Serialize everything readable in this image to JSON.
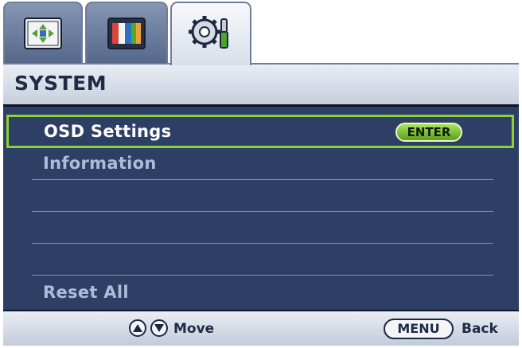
{
  "tabs": [
    {
      "icon": "display-adjust-icon",
      "active": false
    },
    {
      "icon": "picture-icon",
      "active": false
    },
    {
      "icon": "system-gear-icon",
      "active": true
    }
  ],
  "header": {
    "title": "SYSTEM"
  },
  "menu": {
    "items": [
      {
        "label": "OSD Settings",
        "selected": true,
        "badge": "ENTER"
      },
      {
        "label": "Information",
        "selected": false
      },
      {
        "label": "",
        "selected": false
      },
      {
        "label": "",
        "selected": false
      },
      {
        "label": "",
        "selected": false
      },
      {
        "label": "Reset All",
        "selected": false
      }
    ]
  },
  "footer": {
    "move_label": "Move",
    "menu_key": "MENU",
    "back_label": "Back"
  },
  "colors": {
    "body_bg": "#2d3f65",
    "selection_border": "#8fd03a",
    "item_text": "#aebcd9",
    "header_text": "#1f2b44"
  }
}
